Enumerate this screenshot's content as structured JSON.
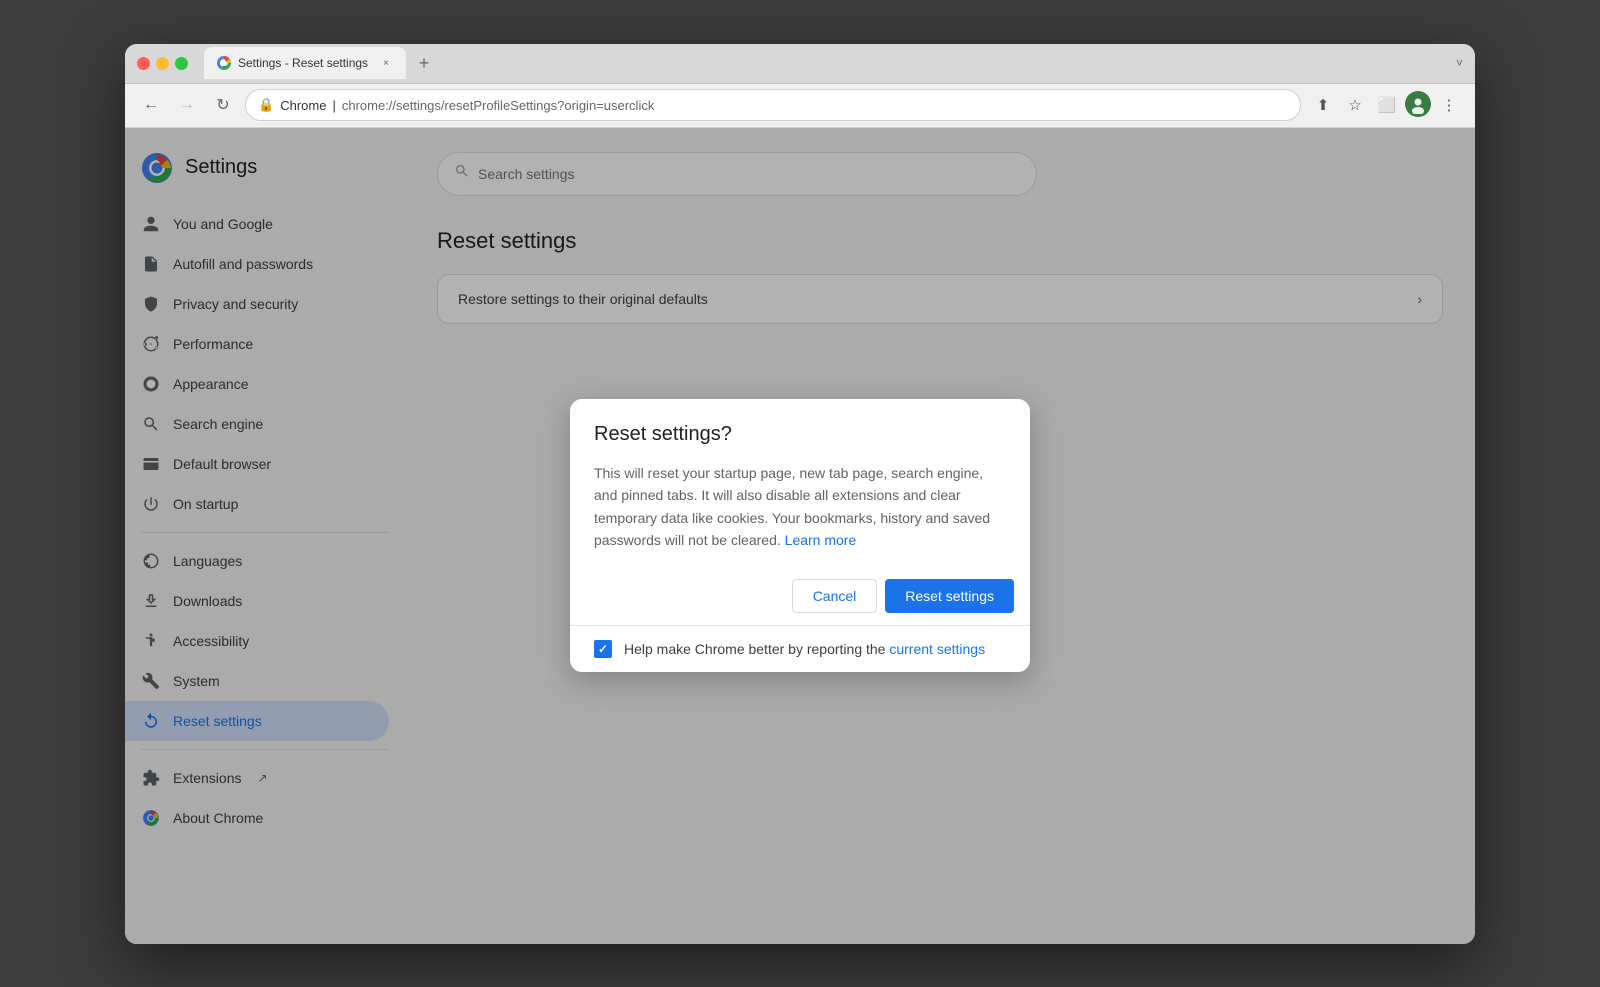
{
  "browser": {
    "tab_label": "Settings - Reset settings",
    "tab_close": "×",
    "tab_new": "+",
    "address_icon": "🔒",
    "address_site": "Chrome",
    "address_separator": " | ",
    "address_url": "chrome://settings/resetProfileSettings?origin=userclick",
    "chevron": "˅"
  },
  "nav": {
    "back": "←",
    "forward": "→",
    "reload": "↻",
    "share": "⬆",
    "bookmark": "☆",
    "tab_icon": "⬜",
    "menu": "⋮"
  },
  "sidebar": {
    "app_title": "Settings",
    "items": [
      {
        "label": "You and Google",
        "icon": "👤",
        "id": "you-google"
      },
      {
        "label": "Autofill and passwords",
        "icon": "📋",
        "id": "autofill"
      },
      {
        "label": "Privacy and security",
        "icon": "🛡",
        "id": "privacy"
      },
      {
        "label": "Performance",
        "icon": "⚡",
        "id": "performance"
      },
      {
        "label": "Appearance",
        "icon": "🎨",
        "id": "appearance"
      },
      {
        "label": "Search engine",
        "icon": "🔍",
        "id": "search-engine"
      },
      {
        "label": "Default browser",
        "icon": "🖥",
        "id": "default-browser"
      },
      {
        "label": "On startup",
        "icon": "⏻",
        "id": "on-startup"
      },
      {
        "label": "Languages",
        "icon": "🌐",
        "id": "languages"
      },
      {
        "label": "Downloads",
        "icon": "⬇",
        "id": "downloads"
      },
      {
        "label": "Accessibility",
        "icon": "♿",
        "id": "accessibility"
      },
      {
        "label": "System",
        "icon": "🔧",
        "id": "system"
      },
      {
        "label": "Reset settings",
        "icon": "↺",
        "id": "reset-settings",
        "active": true
      },
      {
        "label": "Extensions",
        "icon": "🧩",
        "id": "extensions",
        "external": true
      },
      {
        "label": "About Chrome",
        "icon": "ℹ",
        "id": "about-chrome"
      }
    ]
  },
  "main": {
    "search_placeholder": "Search settings",
    "page_title": "Reset settings",
    "card_row_label": "Restore settings to their original defaults",
    "card_row_arrow": "›"
  },
  "dialog": {
    "title": "Reset settings?",
    "body_text": "This will reset your startup page, new tab page, search engine, and pinned tabs. It will also disable all extensions and clear temporary data like cookies. Your bookmarks, history and saved passwords will not be cleared.",
    "learn_more": "Learn more",
    "cancel_label": "Cancel",
    "reset_label": "Reset settings",
    "footer_text": "Help make Chrome better by reporting the ",
    "footer_link": "current settings",
    "checkbox_checked": true
  }
}
